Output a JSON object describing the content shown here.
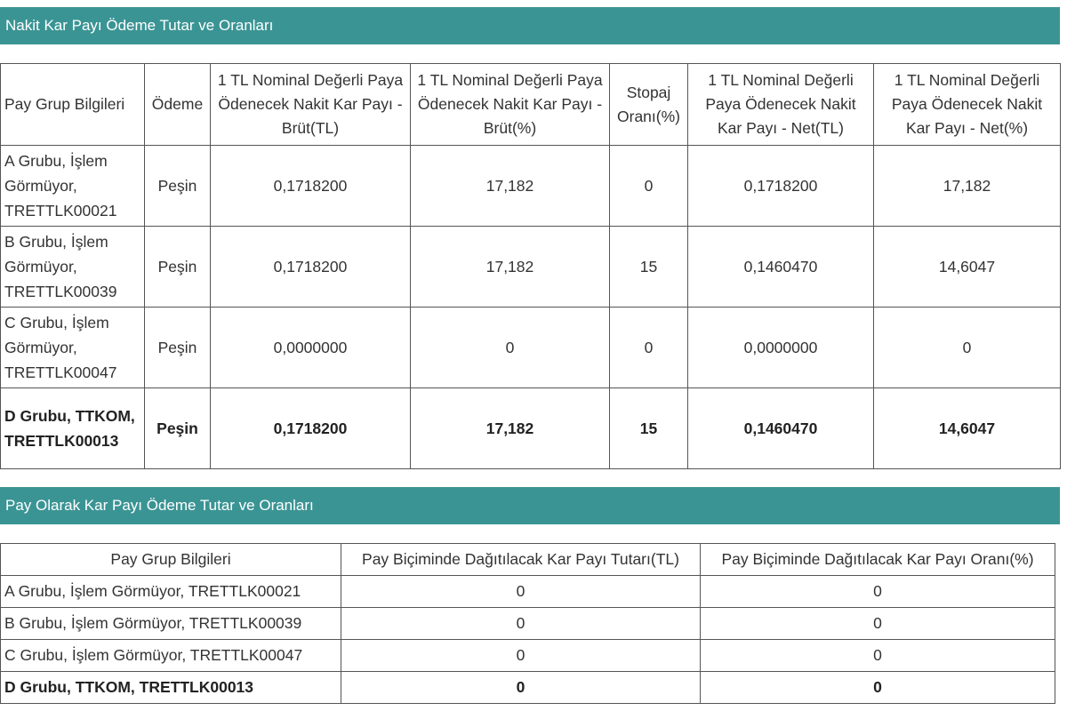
{
  "section1": {
    "title": "Nakit Kar Payı Ödeme Tutar ve Oranları",
    "headers": [
      "Pay Grup Bilgileri",
      "Ödeme",
      "1 TL Nominal Değerli Paya Ödenecek Nakit Kar Payı - Brüt(TL)",
      "1 TL Nominal Değerli Paya Ödenecek Nakit Kar Payı - Brüt(%)",
      "Stopaj Oranı(%)",
      "1 TL Nominal Değerli Paya Ödenecek Nakit Kar Payı - Net(TL)",
      "1 TL Nominal Değerli Paya Ödenecek Nakit Kar Payı - Net(%)"
    ],
    "rows": [
      [
        "A Grubu, İşlem Görmüyor, TRETTLK00021",
        "Peşin",
        "0,1718200",
        "17,182",
        "0",
        "0,1718200",
        "17,182"
      ],
      [
        "B Grubu, İşlem Görmüyor, TRETTLK00039",
        "Peşin",
        "0,1718200",
        "17,182",
        "15",
        "0,1460470",
        "14,6047"
      ],
      [
        "C Grubu, İşlem Görmüyor, TRETTLK00047",
        "Peşin",
        "0,0000000",
        "0",
        "0",
        "0,0000000",
        "0"
      ],
      [
        "D Grubu, TTKOM, TRETTLK00013",
        "Peşin",
        "0,1718200",
        "17,182",
        "15",
        "0,1460470",
        "14,6047"
      ]
    ]
  },
  "section2": {
    "title": "Pay Olarak Kar Payı Ödeme Tutar ve Oranları",
    "headers": [
      "Pay Grup Bilgileri",
      "Pay Biçiminde Dağıtılacak Kar Payı Tutarı(TL)",
      "Pay Biçiminde Dağıtılacak Kar Payı Oranı(%)"
    ],
    "rows": [
      [
        "A Grubu, İşlem Görmüyor, TRETTLK00021",
        "0",
        "0"
      ],
      [
        "B Grubu, İşlem Görmüyor, TRETTLK00039",
        "0",
        "0"
      ],
      [
        "C Grubu, İşlem Görmüyor, TRETTLK00047",
        "0",
        "0"
      ],
      [
        "D Grubu, TTKOM, TRETTLK00013",
        "0",
        "0"
      ]
    ]
  }
}
